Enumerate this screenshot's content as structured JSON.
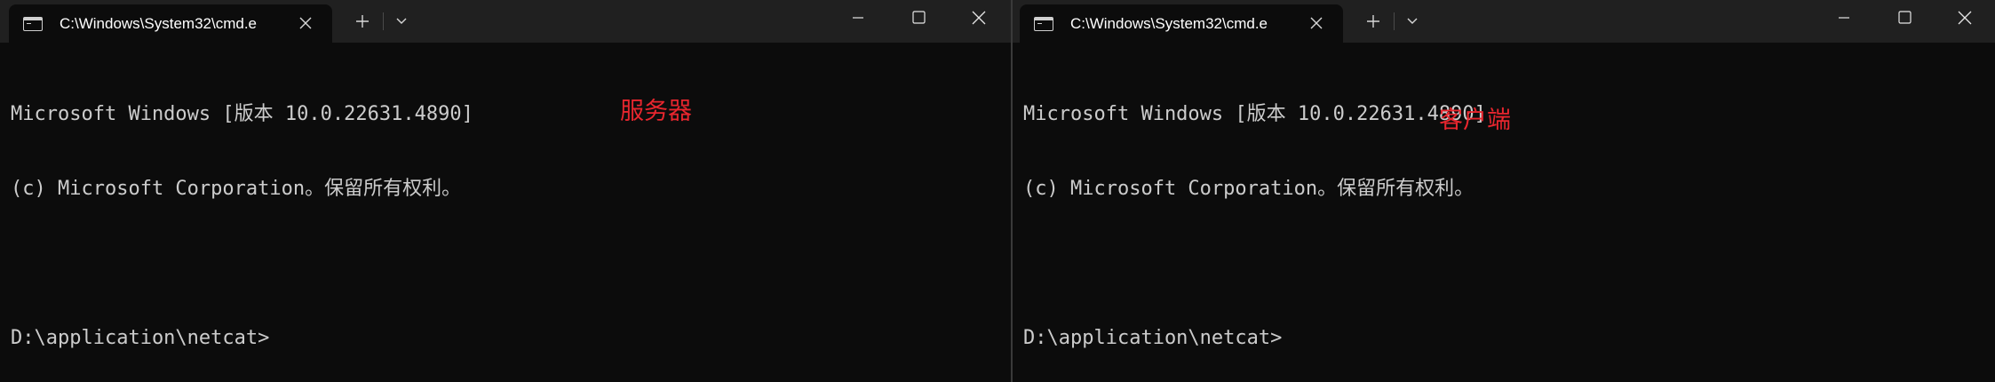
{
  "left_window": {
    "tab_title": "C:\\Windows\\System32\\cmd.e",
    "console_lines": [
      "Microsoft Windows [版本 10.0.22631.4890]",
      "(c) Microsoft Corporation。保留所有权利。",
      "",
      "D:\\application\\netcat>"
    ],
    "annotation": "服务器"
  },
  "right_window": {
    "tab_title": "C:\\Windows\\System32\\cmd.e",
    "console_lines": [
      "Microsoft Windows [版本 10.0.22631.4890]",
      "(c) Microsoft Corporation。保留所有权利。",
      "",
      "D:\\application\\netcat>"
    ],
    "annotation": "客户端"
  },
  "icons": {
    "tab_icon": "terminal-icon",
    "close_tab": "close-icon",
    "new_tab": "plus-icon",
    "dropdown": "chevron-down-icon",
    "minimize": "minimize-icon",
    "maximize": "maximize-icon",
    "close_window": "close-icon"
  },
  "colors": {
    "console_bg": "#0c0c0c",
    "titlebar_bg": "#202020",
    "console_text": "#cccccc",
    "annotation": "#e8262e"
  }
}
